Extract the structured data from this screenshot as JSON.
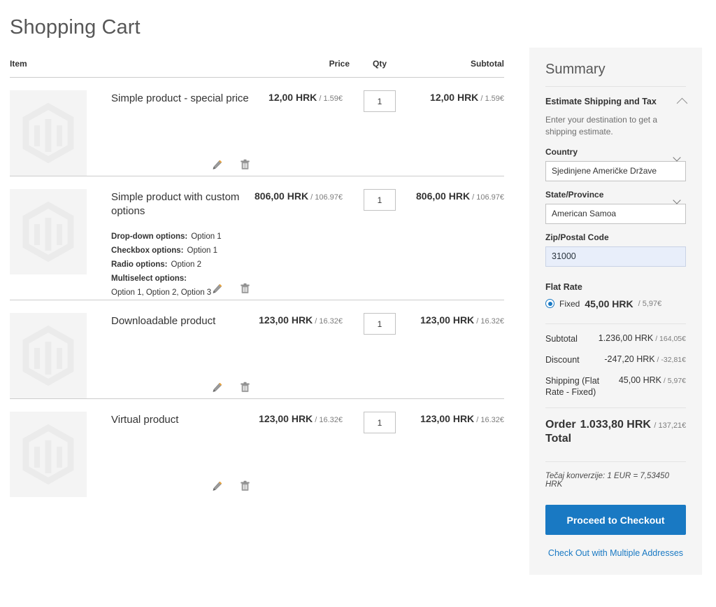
{
  "page": {
    "title": "Shopping Cart"
  },
  "cart": {
    "columns": {
      "item": "Item",
      "price": "Price",
      "qty": "Qty",
      "subtotal": "Subtotal"
    },
    "items": [
      {
        "name": "Simple product - special price",
        "price_main": "12,00 HRK",
        "price_alt": "/ 1.59€",
        "qty": "1",
        "subtotal_main": "12,00 HRK",
        "subtotal_alt": "/ 1.59€",
        "options": [],
        "multiselect_label": "",
        "multiselect_value": "",
        "image_icon": "magento-placeholder-icon",
        "edit_icon": "pencil-icon",
        "delete_icon": "trash-icon"
      },
      {
        "name": "Simple product with custom options",
        "price_main": "806,00 HRK",
        "price_alt": "/ 106.97€",
        "qty": "1",
        "subtotal_main": "806,00 HRK",
        "subtotal_alt": "/ 106.97€",
        "options": [
          {
            "label": "Drop-down options:",
            "value": "Option 1"
          },
          {
            "label": "Checkbox options:",
            "value": "Option 1"
          },
          {
            "label": "Radio options:",
            "value": "Option 2"
          }
        ],
        "multiselect_label": "Multiselect options:",
        "multiselect_value": "Option 1, Option 2, Option 3",
        "image_icon": "magento-placeholder-icon",
        "edit_icon": "pencil-icon",
        "delete_icon": "trash-icon"
      },
      {
        "name": "Downloadable product",
        "price_main": "123,00 HRK",
        "price_alt": "/ 16.32€",
        "qty": "1",
        "subtotal_main": "123,00 HRK",
        "subtotal_alt": "/ 16.32€",
        "options": [],
        "multiselect_label": "",
        "multiselect_value": "",
        "image_icon": "magento-placeholder-icon",
        "edit_icon": "pencil-icon",
        "delete_icon": "trash-icon"
      },
      {
        "name": "Virtual product",
        "price_main": "123,00 HRK",
        "price_alt": "/ 16.32€",
        "qty": "1",
        "subtotal_main": "123,00 HRK",
        "subtotal_alt": "/ 16.32€",
        "options": [],
        "multiselect_label": "",
        "multiselect_value": "",
        "image_icon": "magento-placeholder-icon",
        "edit_icon": "pencil-icon",
        "delete_icon": "trash-icon"
      }
    ]
  },
  "summary": {
    "title": "Summary",
    "estimate": {
      "heading": "Estimate Shipping and Tax",
      "toggle_icon": "chevron-up-icon",
      "note": "Enter your destination to get a shipping estimate.",
      "country_label": "Country",
      "country_value": "Sjedinjene Američke Države",
      "country_options": [
        "Sjedinjene Američke Države"
      ],
      "state_label": "State/Province",
      "state_value": "American Samoa",
      "state_options": [
        "American Samoa"
      ],
      "zip_label": "Zip/Postal Code",
      "zip_value": "31000",
      "zip_placeholder": ""
    },
    "shipping_method": {
      "group_title": "Flat Rate",
      "option_name": "Fixed",
      "option_price_main": "45,00 HRK",
      "option_price_alt": "/ 5,97€",
      "selected": true
    },
    "totals": [
      {
        "label": "Subtotal",
        "value_main": "1.236,00 HRK",
        "value_alt": "/ 164,05€"
      },
      {
        "label": "Discount",
        "value_main": "-247,20 HRK",
        "value_alt": "/ -32,81€"
      },
      {
        "label": "Shipping (Flat Rate - Fixed)",
        "value_main": "45,00 HRK",
        "value_alt": "/ 5,97€"
      }
    ],
    "grand_total": {
      "label": "Order Total",
      "value_main": "1.033,80 HRK",
      "value_alt": "/ 137,21€"
    },
    "conversion_note": "Tečaj konverzije: 1 EUR = 7,53450 HRK",
    "checkout_button": "Proceed to Checkout",
    "multiship_link": "Check Out with Multiple Addresses"
  },
  "colors": {
    "accent": "#1979c3",
    "panel_bg": "#f5f5f5",
    "text": "#333333",
    "muted": "#7d7d7d",
    "border": "#cccccc",
    "zip_bg": "#e8eefa"
  }
}
